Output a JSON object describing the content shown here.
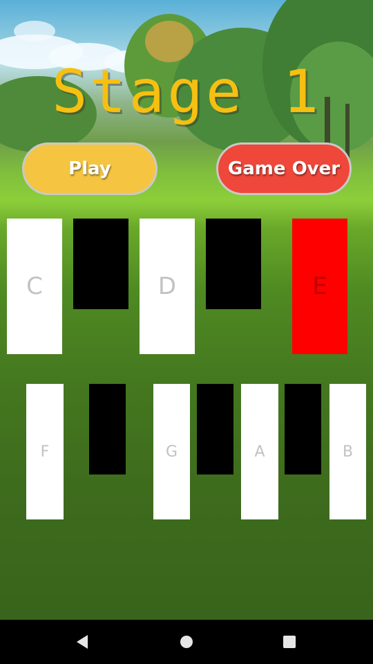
{
  "title": "Stage 1",
  "buttons": {
    "play_label": "Play",
    "game_over_label": "Game Over"
  },
  "keyboard_row_1": [
    {
      "note": "C",
      "type": "white",
      "pressed": false
    },
    {
      "note": "",
      "type": "black",
      "pressed": false
    },
    {
      "note": "D",
      "type": "white",
      "pressed": false
    },
    {
      "note": "",
      "type": "black",
      "pressed": false
    },
    {
      "note": "E",
      "type": "white",
      "pressed": true
    }
  ],
  "keyboard_row_2": [
    {
      "note": "F",
      "type": "white",
      "pressed": false
    },
    {
      "note": "",
      "type": "black",
      "pressed": false
    },
    {
      "note": "G",
      "type": "white",
      "pressed": false
    },
    {
      "note": "",
      "type": "black",
      "pressed": false
    },
    {
      "note": "A",
      "type": "white",
      "pressed": false
    },
    {
      "note": "",
      "type": "black",
      "pressed": false
    },
    {
      "note": "B",
      "type": "white",
      "pressed": false
    }
  ],
  "colors": {
    "title": "#f6c012",
    "play_button": "#f5c542",
    "game_over_button": "#ef473a",
    "pressed_key": "#ff0000",
    "white_key": "#ffffff",
    "black_key": "#000000"
  },
  "nav_bar": {
    "back_icon": "back-triangle-icon",
    "home_icon": "home-circle-icon",
    "recents_icon": "recents-square-icon"
  }
}
